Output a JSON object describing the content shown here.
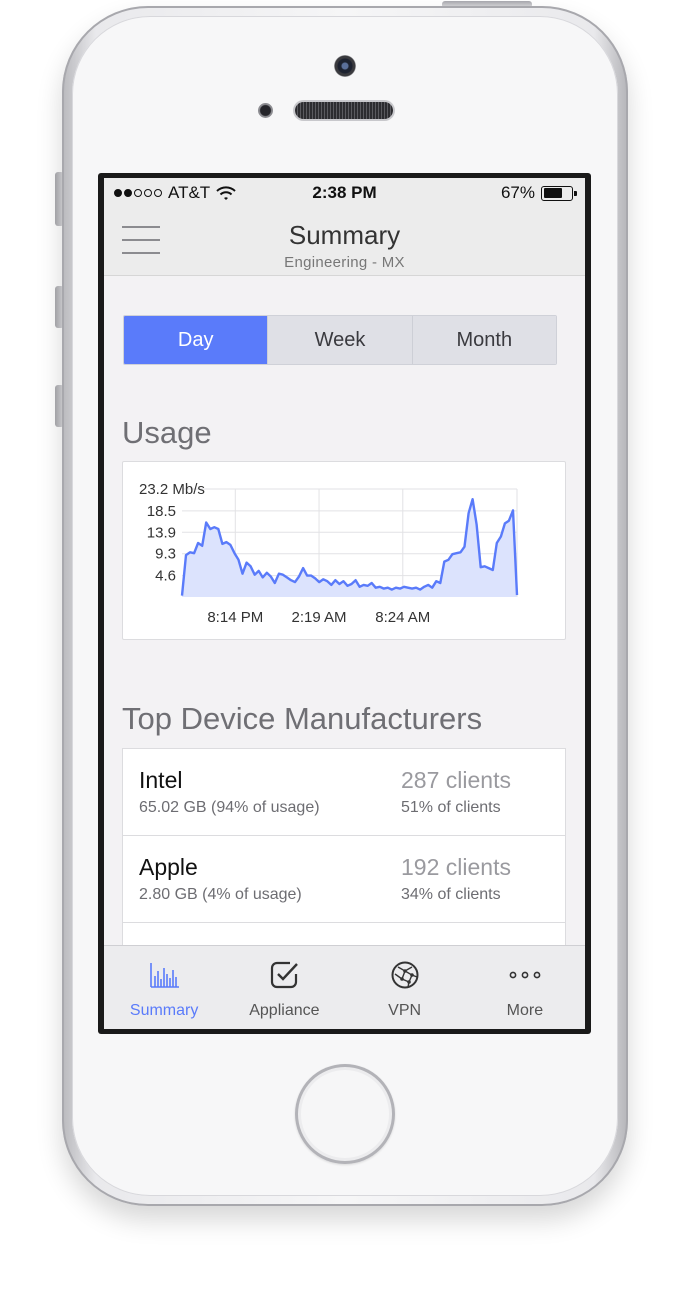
{
  "status_bar": {
    "carrier": "AT&T",
    "time": "2:38 PM",
    "battery": "67%",
    "battery_level": 0.67,
    "signal_bars": 2,
    "signal_total": 5
  },
  "nav": {
    "title": "Summary",
    "subtitle": "Engineering - MX",
    "menu_icon": "hamburger-menu-icon"
  },
  "segments": [
    {
      "label": "Day",
      "active": true
    },
    {
      "label": "Week",
      "active": false
    },
    {
      "label": "Month",
      "active": false
    }
  ],
  "usage": {
    "title": "Usage"
  },
  "chart_data": {
    "type": "area",
    "title": "",
    "xlabel": "",
    "ylabel": "",
    "y_ticks": [
      "23.2 Mb/s",
      "18.5",
      "13.9",
      "9.3",
      "4.6"
    ],
    "y_tick_values": [
      23.2,
      18.5,
      13.9,
      9.3,
      4.6
    ],
    "x_ticks": [
      "8:14 PM",
      "2:19 AM",
      "8:24 AM"
    ],
    "x_tick_positions": [
      14,
      36,
      58
    ],
    "xlim": [
      0,
      88
    ],
    "ylim": [
      0,
      23.2
    ],
    "grid": true,
    "color": "#5a7bfa",
    "fill": "#dce3fd",
    "series": [
      {
        "values": [
          0.3,
          9.0,
          9.6,
          9.4,
          11.6,
          11.0,
          16.0,
          14.6,
          15.0,
          14.6,
          11.4,
          11.8,
          11.2,
          9.4,
          8.0,
          5.0,
          7.4,
          6.6,
          4.8,
          5.6,
          4.2,
          5.2,
          4.4,
          3.0,
          5.0,
          4.8,
          4.2,
          3.6,
          3.2,
          4.4,
          6.2,
          4.6,
          4.6,
          4.0,
          3.2,
          3.8,
          3.4,
          2.6,
          3.6,
          2.8,
          3.4,
          2.4,
          2.8,
          3.6,
          2.2,
          2.6,
          2.4,
          3.0,
          2.0,
          2.2,
          1.8,
          2.0,
          1.6,
          2.0,
          1.8,
          2.2,
          2.0,
          1.8,
          2.0,
          1.6,
          2.2,
          2.6,
          2.0,
          3.4,
          3.0,
          7.6,
          8.0,
          9.2,
          9.4,
          9.6,
          10.8,
          18.0,
          21.0,
          15.6,
          6.4,
          6.6,
          6.2,
          5.8,
          11.6,
          13.0,
          15.8,
          16.4,
          18.6,
          0.4
        ]
      }
    ]
  },
  "manufacturers": {
    "title": "Top Device Manufacturers",
    "rows": [
      {
        "name": "Intel",
        "usage": "65.02 GB (94% of usage)",
        "clients": "287 clients",
        "clients_pct": "51% of clients"
      },
      {
        "name": "Apple",
        "usage": "2.80 GB (4% of usage)",
        "clients": "192 clients",
        "clients_pct": "34% of clients"
      }
    ]
  },
  "tabs": [
    {
      "label": "Summary",
      "icon": "bar-chart-icon",
      "active": true
    },
    {
      "label": "Appliance",
      "icon": "check-badge-icon",
      "active": false
    },
    {
      "label": "VPN",
      "icon": "globe-network-icon",
      "active": false
    },
    {
      "label": "More",
      "icon": "ellipsis-icon",
      "active": false
    }
  ],
  "colors": {
    "accent": "#5a7bfa",
    "chart_fill": "#dce3fd",
    "background": "#f3f2f4"
  }
}
